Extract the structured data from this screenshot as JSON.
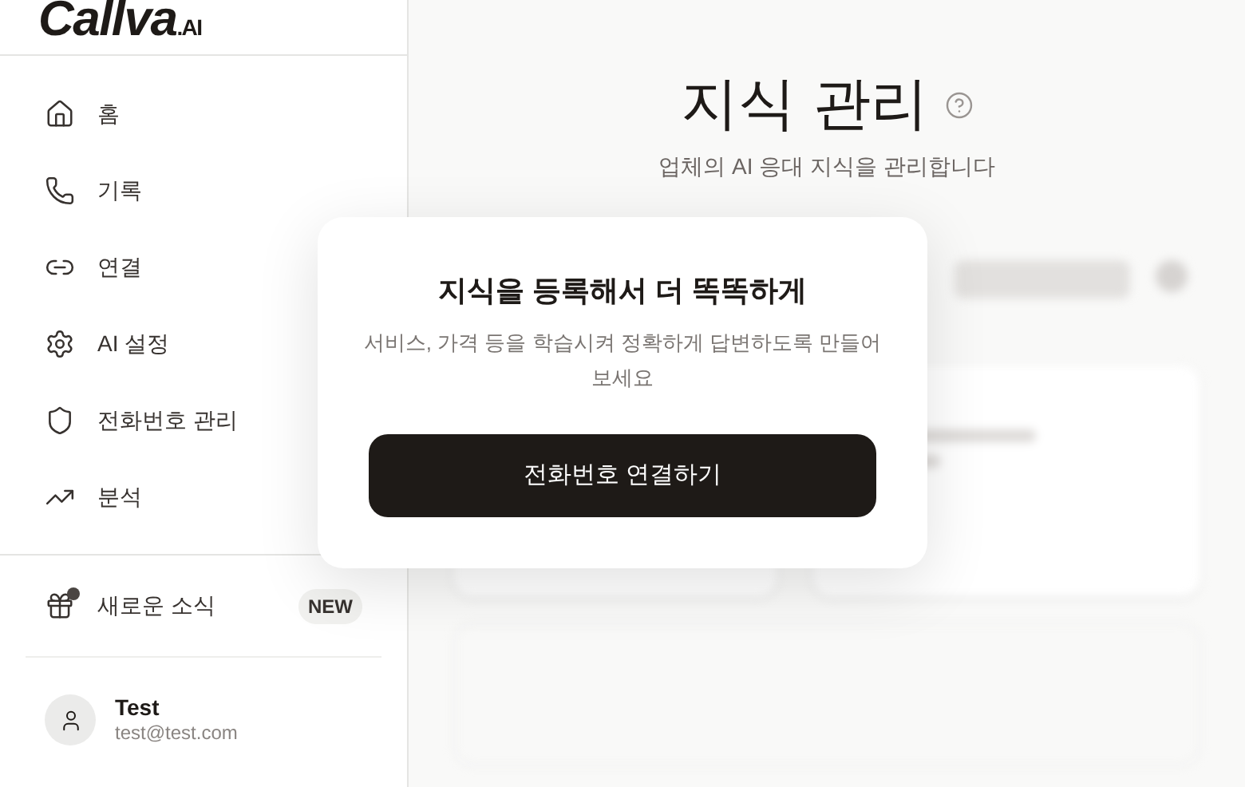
{
  "sidebar": {
    "logo": {
      "name": "Callva",
      "suffix": ".AI"
    },
    "nav": [
      {
        "label": "홈"
      },
      {
        "label": "기록"
      },
      {
        "label": "연결"
      },
      {
        "label": "AI 설정"
      },
      {
        "label": "전화번호 관리"
      },
      {
        "label": "분석"
      }
    ],
    "news": {
      "label": "새로운 소식",
      "badge": "NEW",
      "unread": true
    },
    "user": {
      "name": "Test",
      "email": "test@test.com"
    }
  },
  "main": {
    "title": "지식 관리",
    "subtitle": "업체의 AI 응대 지식을 관리합니다"
  },
  "modal": {
    "title": "지식을 등록해서 더 똑똑하게",
    "description": "서비스, 가격 등을 학습시켜 정확하게 답변하도록 만들어보세요",
    "button": "전화번호 연결하기"
  }
}
